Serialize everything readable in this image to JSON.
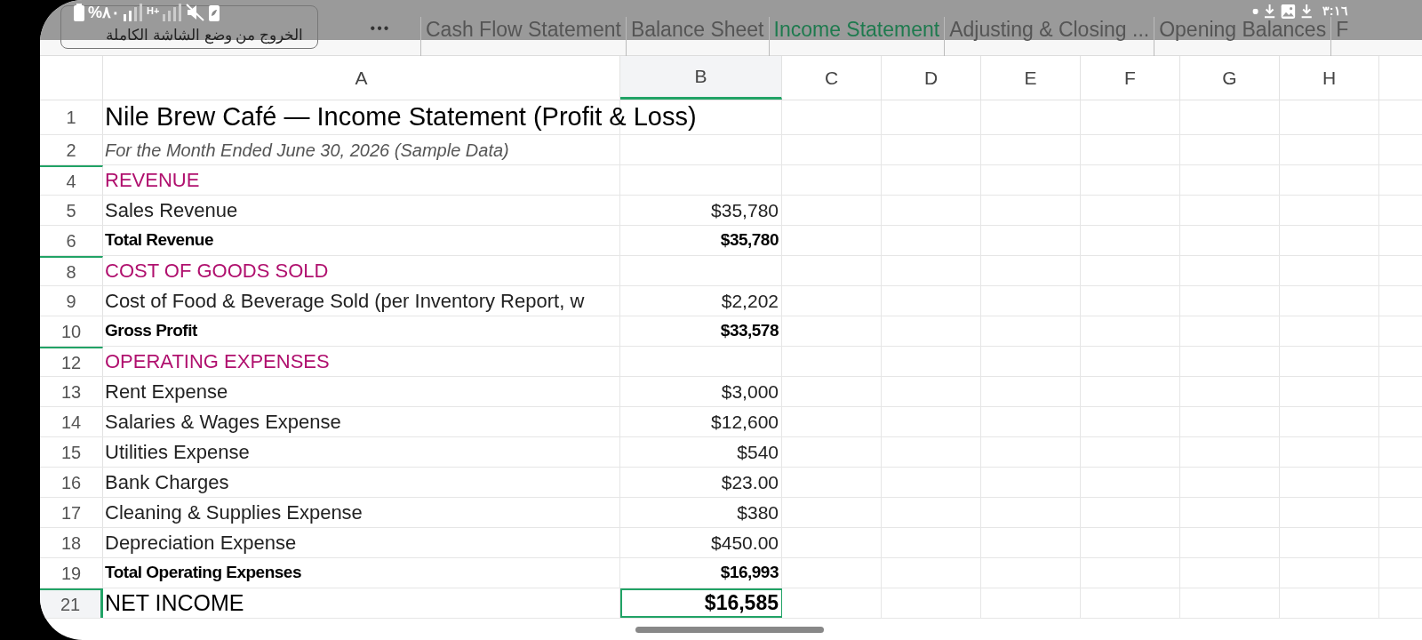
{
  "status_bar": {
    "battery": "%٨٠",
    "network": "H+",
    "time": "٣:١٦"
  },
  "exit_fullscreen_button": {
    "label": "الخروج من وضع الشاشة الكاملة"
  },
  "more_button": {
    "label": "•••"
  },
  "sheet_tabs": [
    {
      "label": "Cash Flow Statement",
      "selected": false
    },
    {
      "label": "Balance Sheet",
      "selected": false
    },
    {
      "label": "Income Statement",
      "selected": true
    },
    {
      "label": "Adjusting & Closing ...",
      "selected": false
    },
    {
      "label": "Opening Balances",
      "selected": false
    },
    {
      "label": "F",
      "selected": false
    }
  ],
  "columns": [
    {
      "label": "A",
      "selected": false
    },
    {
      "label": "B",
      "selected": true
    },
    {
      "label": "C",
      "selected": false
    },
    {
      "label": "D",
      "selected": false
    },
    {
      "label": "E",
      "selected": false
    },
    {
      "label": "F",
      "selected": false
    },
    {
      "label": "G",
      "selected": false
    },
    {
      "label": "H",
      "selected": false
    }
  ],
  "rows": [
    {
      "number": "1",
      "kind": "title",
      "label": "Nile Brew Café — Income Statement (Profit & Loss)",
      "hidden_above": false,
      "selected": false
    },
    {
      "number": "2",
      "kind": "subtitle",
      "label": "For the Month Ended June 30, 2026 (Sample Data)",
      "hidden_above": false,
      "selected": false
    },
    {
      "number": "4",
      "kind": "section",
      "label": "REVENUE",
      "hidden_above": true,
      "selected": false
    },
    {
      "number": "5",
      "kind": "item",
      "label": "Sales Revenue",
      "value": "$35,780",
      "hidden_above": false,
      "selected": false
    },
    {
      "number": "6",
      "kind": "total",
      "label": "Total Revenue",
      "value": "$35,780",
      "hidden_above": false,
      "selected": false
    },
    {
      "number": "8",
      "kind": "section",
      "label": "COST OF GOODS SOLD",
      "hidden_above": true,
      "selected": false
    },
    {
      "number": "9",
      "kind": "item",
      "label": "Cost of Food & Beverage Sold (per Inventory Report, w",
      "value": "$2,202",
      "hidden_above": false,
      "selected": false
    },
    {
      "number": "10",
      "kind": "total",
      "label": "Gross Profit",
      "value": "$33,578",
      "hidden_above": false,
      "selected": false
    },
    {
      "number": "12",
      "kind": "section",
      "label": "OPERATING EXPENSES",
      "hidden_above": true,
      "selected": false
    },
    {
      "number": "13",
      "kind": "item",
      "label": "Rent Expense",
      "value": "$3,000",
      "hidden_above": false,
      "selected": false
    },
    {
      "number": "14",
      "kind": "item",
      "label": "Salaries & Wages Expense",
      "value": "$12,600",
      "hidden_above": false,
      "selected": false
    },
    {
      "number": "15",
      "kind": "item",
      "label": "Utilities Expense",
      "value": "$540",
      "hidden_above": false,
      "selected": false
    },
    {
      "number": "16",
      "kind": "item",
      "label": "Bank Charges",
      "value": "$23.00",
      "hidden_above": false,
      "selected": false
    },
    {
      "number": "17",
      "kind": "item",
      "label": "Cleaning & Supplies Expense",
      "value": "$380",
      "hidden_above": false,
      "selected": false
    },
    {
      "number": "18",
      "kind": "item",
      "label": "Depreciation Expense",
      "value": "$450.00",
      "hidden_above": false,
      "selected": false
    },
    {
      "number": "19",
      "kind": "total",
      "label": "Total Operating Expenses",
      "value": "$16,993",
      "hidden_above": false,
      "selected": false
    },
    {
      "number": "21",
      "kind": "net",
      "label": "NET INCOME",
      "value": "$16,585",
      "hidden_above": true,
      "selected": true
    }
  ]
}
